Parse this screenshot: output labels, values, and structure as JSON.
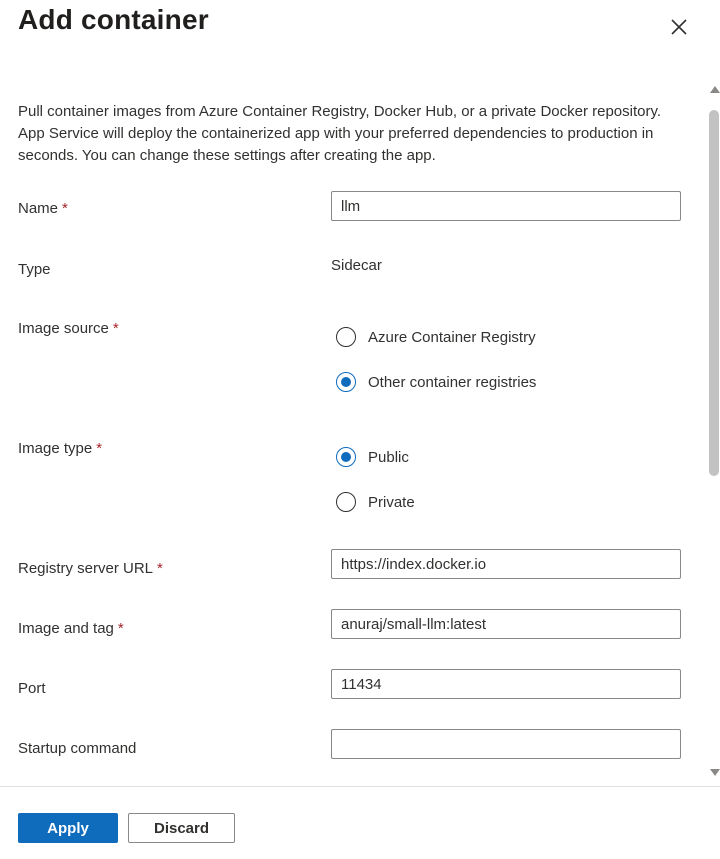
{
  "panel": {
    "title": "Add container",
    "intro": "Pull container images from Azure Container Registry, Docker Hub, or a private Docker repository. App Service will deploy the containerized app with your preferred dependencies to production in seconds. You can change these settings after creating the app."
  },
  "form": {
    "name": {
      "label": "Name",
      "required": "*",
      "value": "llm"
    },
    "type": {
      "label": "Type",
      "value": "Sidecar"
    },
    "image_source": {
      "label": "Image source",
      "required": "*",
      "options": [
        "Azure Container Registry",
        "Other container registries"
      ],
      "selected": "Other container registries"
    },
    "image_type": {
      "label": "Image type",
      "required": "*",
      "options": [
        "Public",
        "Private"
      ],
      "selected": "Public"
    },
    "registry_url": {
      "label": "Registry server URL",
      "required": "*",
      "value": "https://index.docker.io"
    },
    "image_tag": {
      "label": "Image and tag",
      "required": "*",
      "value": "anuraj/small-llm:latest"
    },
    "port": {
      "label": "Port",
      "value": "11434"
    },
    "startup": {
      "label": "Startup command",
      "value": ""
    }
  },
  "footer": {
    "apply_label": "Apply",
    "discard_label": "Discard"
  },
  "colors": {
    "accent": "#0f6cbd",
    "required": "#a4262c",
    "text": "#323130"
  },
  "icons": {
    "close": "close-icon"
  }
}
